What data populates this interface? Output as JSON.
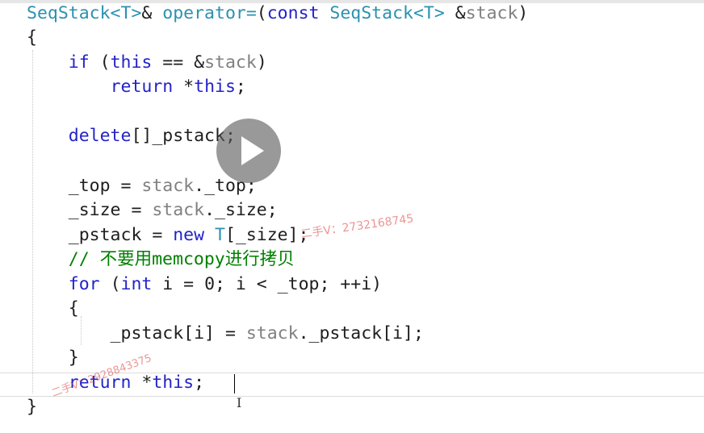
{
  "editor": {
    "lines": [
      [
        {
          "t": "SeqStack<T>",
          "c": "ty"
        },
        {
          "t": "& ",
          "c": ""
        },
        {
          "t": "operator=",
          "c": "ty"
        },
        {
          "t": "(",
          "c": ""
        },
        {
          "t": "const ",
          "c": "kw"
        },
        {
          "t": "SeqStack<T>",
          "c": "ty"
        },
        {
          "t": " &",
          "c": ""
        },
        {
          "t": "stack",
          "c": "mem"
        },
        {
          "t": ")",
          "c": ""
        }
      ],
      [
        {
          "t": "{",
          "c": ""
        }
      ],
      [
        {
          "t": "    ",
          "c": ""
        },
        {
          "t": "if ",
          "c": "kw"
        },
        {
          "t": "(",
          "c": ""
        },
        {
          "t": "this",
          "c": "kw"
        },
        {
          "t": " == &",
          "c": ""
        },
        {
          "t": "stack",
          "c": "mem"
        },
        {
          "t": ")",
          "c": ""
        }
      ],
      [
        {
          "t": "        ",
          "c": ""
        },
        {
          "t": "return ",
          "c": "kw"
        },
        {
          "t": "*",
          "c": ""
        },
        {
          "t": "this",
          "c": "kw"
        },
        {
          "t": ";",
          "c": ""
        }
      ],
      [],
      [
        {
          "t": "    ",
          "c": ""
        },
        {
          "t": "delete",
          "c": "kw"
        },
        {
          "t": "[]_pstack;",
          "c": ""
        }
      ],
      [],
      [
        {
          "t": "    _top = ",
          "c": ""
        },
        {
          "t": "stack",
          "c": "mem"
        },
        {
          "t": "._top;",
          "c": ""
        }
      ],
      [
        {
          "t": "    _size = ",
          "c": ""
        },
        {
          "t": "stack",
          "c": "mem"
        },
        {
          "t": "._size;",
          "c": ""
        }
      ],
      [
        {
          "t": "    _pstack = ",
          "c": ""
        },
        {
          "t": "new ",
          "c": "kw"
        },
        {
          "t": "T",
          "c": "ty"
        },
        {
          "t": "[_size];",
          "c": ""
        }
      ],
      [
        {
          "t": "    ",
          "c": ""
        },
        {
          "t": "// 不要用memcopy进行拷贝",
          "c": "com"
        }
      ],
      [
        {
          "t": "    ",
          "c": ""
        },
        {
          "t": "for ",
          "c": "kw"
        },
        {
          "t": "(",
          "c": ""
        },
        {
          "t": "int ",
          "c": "kw"
        },
        {
          "t": "i = 0; i < _top; ++i)",
          "c": ""
        }
      ],
      [
        {
          "t": "    {",
          "c": ""
        }
      ],
      [
        {
          "t": "        _pstack[i] = ",
          "c": ""
        },
        {
          "t": "stack",
          "c": "mem"
        },
        {
          "t": "._pstack[i];",
          "c": ""
        }
      ],
      [
        {
          "t": "    }",
          "c": ""
        }
      ],
      [
        {
          "t": "    ",
          "c": ""
        },
        {
          "t": "return ",
          "c": "kw"
        },
        {
          "t": "*",
          "c": ""
        },
        {
          "t": "this",
          "c": "kw"
        },
        {
          "t": ";",
          "c": ""
        }
      ],
      [
        {
          "t": "}",
          "c": ""
        }
      ]
    ]
  },
  "watermarks": {
    "wm1": "二手V：2732168745",
    "wm2": "二手V：2928843375"
  }
}
